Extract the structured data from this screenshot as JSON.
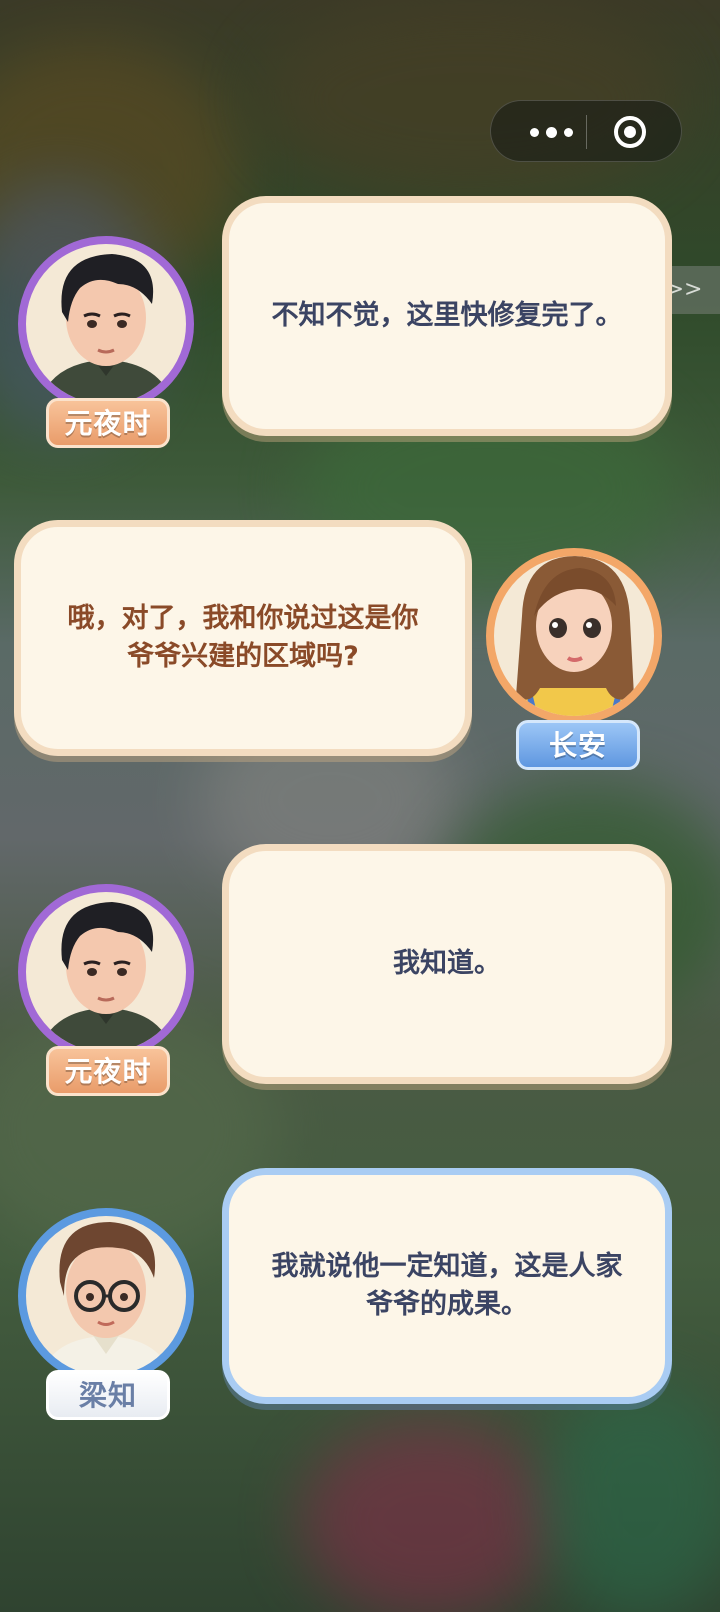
{
  "capsule": {
    "more_icon": "more-dots-icon",
    "close_icon": "target-circle-icon"
  },
  "skip": {
    "label": ">>"
  },
  "colors": {
    "bubble_fill": "#fdf6e8",
    "warm_border": "#f3dcc0",
    "cool_border": "#a9ccf3",
    "text_dark": "#3b4463",
    "text_brown": "#8a4a28"
  },
  "dialogues": [
    {
      "speaker": "元夜时",
      "text": "不知不觉，这里快修复完了。"
    },
    {
      "speaker": "长安",
      "text": "哦，对了，我和你说过这是你爷爷兴建的区域吗?"
    },
    {
      "speaker": "元夜时",
      "text": "我知道。"
    },
    {
      "speaker": "梁知",
      "text": "我就说他一定知道，这是人家爷爷的成果。"
    }
  ]
}
